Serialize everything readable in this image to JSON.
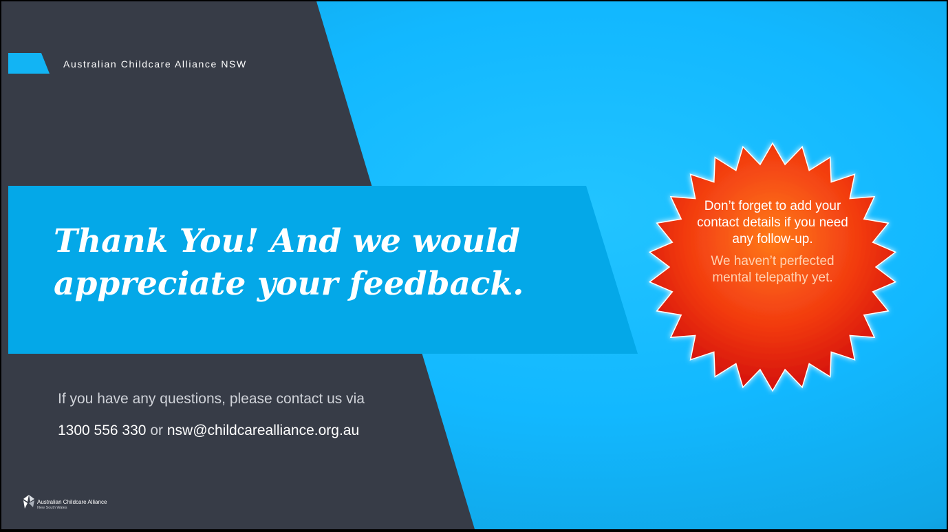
{
  "header": {
    "org_name": "Australian Childcare Alliance NSW"
  },
  "title": {
    "line1": "Thank You! And we would",
    "line2": "appreciate your feedback."
  },
  "contact": {
    "prompt": "If you have any questions, please contact us via",
    "phone": "1300 556 330",
    "connector": "or",
    "email": "nsw@childcarealliance.org.au"
  },
  "badge": {
    "main": "Don’t forget to add your contact details if you need any follow-up.",
    "sub": "We haven’t perfected mental telepathy yet."
  },
  "logo": {
    "name": "Australian Childcare Alliance",
    "subtitle": "New South Wales"
  },
  "colors": {
    "dark_panel": "#373c47",
    "cyan_banner": "#04a8e8",
    "sky_background": "#13b8ff",
    "badge_red": "#e81d0c",
    "badge_orange": "#ff7a1a"
  }
}
